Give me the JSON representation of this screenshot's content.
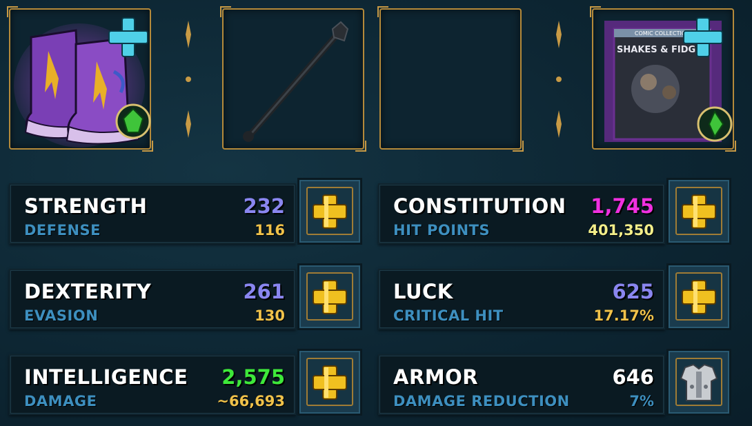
{
  "equipment": {
    "boots": {
      "icon": "purple-boots-icon",
      "upgrade": "plus-icon",
      "gem": "green-gem-icon"
    },
    "weapon": {
      "icon": "black-staff-icon"
    },
    "shield": {
      "icon": "empty-slot"
    },
    "book": {
      "icon": "comic-book-icon",
      "title": "SHAKES & FIDGET",
      "subtitle": "COMIC COLLECTION",
      "upgrade": "plus-icon",
      "gem": "green-gem-icon"
    }
  },
  "stats": [
    {
      "name": "STRENGTH",
      "value": "232",
      "value_color": "#8a86f0",
      "sub_name": "DEFENSE",
      "sub_value": "116",
      "sub_color": "#f0c24a",
      "action": "plus-icon"
    },
    {
      "name": "CONSTITUTION",
      "value": "1,745",
      "value_color": "#f030e0",
      "sub_name": "HIT POINTS",
      "sub_value": "401,350",
      "sub_color": "#f2ee8a",
      "action": "plus-icon"
    },
    {
      "name": "DEXTERITY",
      "value": "261",
      "value_color": "#8a86f0",
      "sub_name": "EVASION",
      "sub_value": "130",
      "sub_color": "#f0c24a",
      "action": "plus-icon"
    },
    {
      "name": "LUCK",
      "value": "625",
      "value_color": "#8a86f0",
      "sub_name": "CRITICAL HIT",
      "sub_value": "17.17%",
      "sub_color": "#f0c24a",
      "action": "plus-icon"
    },
    {
      "name": "INTELLIGENCE",
      "value": "2,575",
      "value_color": "#3ee83a",
      "sub_name": "DAMAGE",
      "sub_value": "~66,693",
      "sub_color": "#f0c24a",
      "action": "plus-icon"
    },
    {
      "name": "ARMOR",
      "value": "646",
      "value_color": "#ffffff",
      "sub_name": "DAMAGE REDUCTION",
      "sub_value": "7%",
      "sub_color": "#3d8fbf",
      "action": "armor-chest-icon"
    }
  ]
}
